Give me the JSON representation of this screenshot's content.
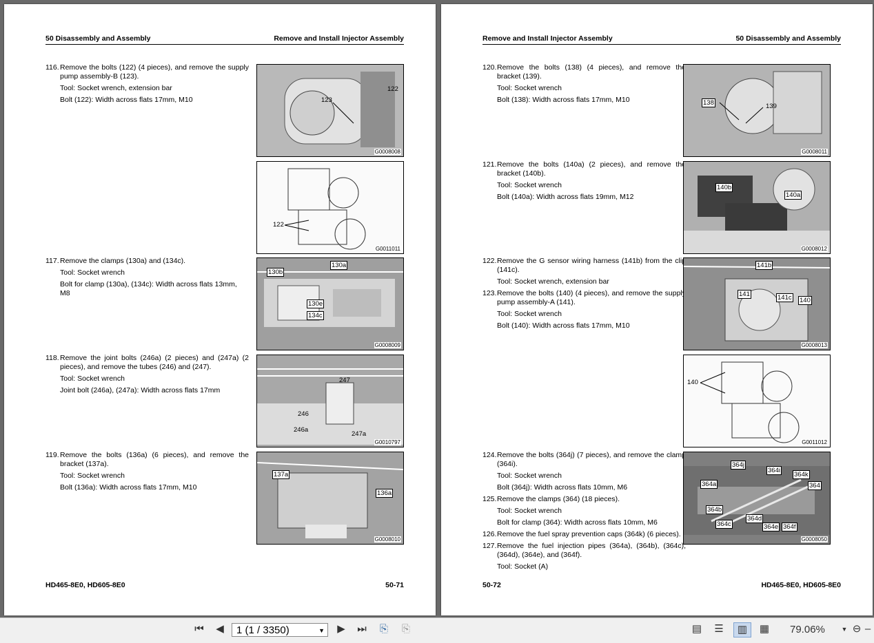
{
  "left_page": {
    "header_left": "50 Disassembly and Assembly",
    "header_right": "Remove and Install Injector Assembly",
    "footer_left": "HD465-8E0, HD605-8E0",
    "footer_right": "50-71",
    "steps": [
      {
        "num": "116.",
        "text": "Remove the bolts (122) (4 pieces), and remove the supply pump assembly-B (123).",
        "subs": [
          "Tool: Socket wrench, extension bar",
          "Bolt (122): Width across flats 17mm, M10"
        ]
      },
      {
        "num": "117.",
        "text": "Remove the clamps (130a) and (134c).",
        "subs": [
          "Tool: Socket wrench",
          "Bolt for clamp (130a), (134c): Width across flats 13mm, M8"
        ]
      },
      {
        "num": "118.",
        "text": "Remove the joint bolts (246a) (2 pieces) and (247a) (2 pieces), and remove the tubes (246) and (247).",
        "subs": [
          "Tool: Socket wrench",
          "Joint bolt (246a), (247a): Width across flats 17mm"
        ]
      },
      {
        "num": "119.",
        "text": "Remove the bolts (136a) (6 pieces), and remove the bracket (137a).",
        "subs": [
          "Tool: Socket wrench",
          "Bolt (136a): Width across flats 17mm, M10"
        ]
      }
    ],
    "figures": [
      {
        "code": "G0008008",
        "callouts": [
          "123",
          "122"
        ]
      },
      {
        "code": "G0011011",
        "callouts": [
          "122"
        ]
      },
      {
        "code": "G0008009",
        "callouts": [
          "130b",
          "130a",
          "130e",
          "134c"
        ]
      },
      {
        "code": "G0010797",
        "callouts": [
          "247",
          "246",
          "246a",
          "247a"
        ]
      },
      {
        "code": "G0008010",
        "callouts": [
          "137a",
          "136a"
        ]
      }
    ]
  },
  "right_page": {
    "header_left": "Remove and Install Injector Assembly",
    "header_right": "50 Disassembly and Assembly",
    "footer_left": "50-72",
    "footer_right": "HD465-8E0, HD605-8E0",
    "steps": [
      {
        "num": "120.",
        "text": "Remove the bolts (138) (4 pieces), and remove the bracket (139).",
        "subs": [
          "Tool: Socket wrench",
          "Bolt (138): Width across flats 17mm, M10"
        ]
      },
      {
        "num": "121.",
        "text": "Remove the bolts (140a) (2 pieces), and remove the bracket (140b).",
        "subs": [
          "Tool: Socket wrench",
          "Bolt (140a): Width across flats 19mm, M12"
        ]
      },
      {
        "num": "122.",
        "text": "Remove the G sensor wiring harness (141b) from the clip (141c).",
        "subs": [
          "Tool: Socket wrench, extension bar"
        ]
      },
      {
        "num": "123.",
        "text": "Remove the bolts (140) (4 pieces), and remove the supply pump assembly-A (141).",
        "subs": [
          "Tool: Socket wrench",
          "Bolt (140): Width across flats 17mm, M10"
        ]
      },
      {
        "num": "124.",
        "text": "Remove the bolts (364j) (7 pieces), and remove the clamp (364i).",
        "subs": [
          "Tool: Socket wrench",
          "Bolt (364j): Width across flats 10mm, M6"
        ]
      },
      {
        "num": "125.",
        "text": "Remove the clamps (364) (18 pieces).",
        "subs": [
          "Tool: Socket wrench",
          "Bolt for clamp (364): Width across flats 10mm, M6"
        ]
      },
      {
        "num": "126.",
        "text": "Remove the fuel spray prevention caps (364k) (6 pieces).",
        "subs": []
      },
      {
        "num": "127.",
        "text": "Remove the fuel injection pipes (364a), (364b), (364c), (364d), (364e), and (364f).",
        "subs": [
          "Tool: Socket (A)"
        ]
      }
    ],
    "figures": [
      {
        "code": "G0008011",
        "callouts": [
          "138",
          "139"
        ]
      },
      {
        "code": "G0008012",
        "callouts": [
          "140b",
          "140a"
        ]
      },
      {
        "code": "G0008013",
        "callouts": [
          "141b",
          "141",
          "141c",
          "140"
        ]
      },
      {
        "code": "G0011012",
        "callouts": [
          "140"
        ]
      },
      {
        "code": "G0008050",
        "callouts": [
          "364j",
          "364i",
          "364k",
          "364a",
          "364",
          "364b",
          "364d",
          "364c",
          "364e",
          "364f"
        ]
      }
    ]
  },
  "toolbar": {
    "page_indicator": "1 (1 / 3350)",
    "zoom": "79.06%",
    "icons": [
      "first-page-icon",
      "previous-page-icon",
      "next-page-icon",
      "last-page-icon",
      "previous-view-icon",
      "next-view-icon",
      "single-page-icon",
      "continuous-page-icon",
      "facing-pages-icon",
      "continuous-facing-icon",
      "zoom-dropdown-icon",
      "zoom-out-icon"
    ]
  }
}
